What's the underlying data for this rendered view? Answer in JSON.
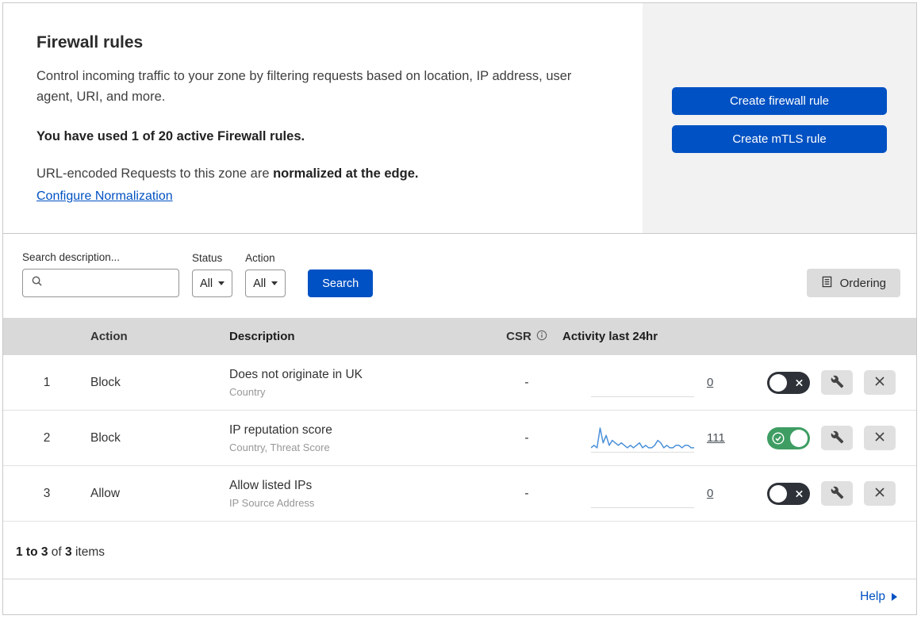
{
  "header": {
    "title": "Firewall rules",
    "description": "Control incoming traffic to your zone by filtering requests based on location, IP address, user agent, URI, and more.",
    "usage": "You have used 1 of 20 active Firewall rules.",
    "normalization_prefix": "URL-encoded Requests to this zone are ",
    "normalization_bold": "normalized at the edge.",
    "normalization_link": "Configure Normalization",
    "buttons": {
      "create_firewall": "Create firewall rule",
      "create_mtls": "Create mTLS rule"
    }
  },
  "filters": {
    "search_label": "Search description...",
    "status_label": "Status",
    "status_value": "All",
    "action_label": "Action",
    "action_value": "All",
    "search_button": "Search",
    "ordering_button": "Ordering"
  },
  "table": {
    "columns": {
      "action": "Action",
      "description": "Description",
      "csr": "CSR",
      "activity": "Activity last 24hr"
    },
    "rows": [
      {
        "priority": "1",
        "action": "Block",
        "description": "Does not originate in UK",
        "fields": "Country",
        "csr": "-",
        "activity_count": "0",
        "enabled": false,
        "sparkline": []
      },
      {
        "priority": "2",
        "action": "Block",
        "description": "IP reputation score",
        "fields": "Country, Threat Score",
        "csr": "-",
        "activity_count": "111",
        "enabled": true,
        "sparkline": [
          1,
          2,
          1,
          9,
          3,
          6,
          2,
          4,
          3,
          2,
          3,
          2,
          1,
          2,
          1,
          2,
          3,
          1,
          2,
          1,
          1,
          2,
          4,
          3,
          1,
          2,
          1,
          1,
          2,
          2,
          1,
          2,
          2,
          1,
          1
        ]
      },
      {
        "priority": "3",
        "action": "Allow",
        "description": "Allow listed IPs",
        "fields": "IP Source Address",
        "csr": "-",
        "activity_count": "0",
        "enabled": false,
        "sparkline": []
      }
    ]
  },
  "footer": {
    "range_bold": "1 to 3",
    "of_text": "of",
    "total_bold": "3",
    "items_text": "items",
    "help": "Help"
  },
  "colors": {
    "primary_blue": "#0051c3",
    "toggle_on_green": "#3e9d63",
    "toggle_off_dark": "#2e3238",
    "table_header_gray": "#d9d9d9",
    "panel_gray": "#f2f2f2",
    "sparkline_blue": "#4a90d9"
  }
}
